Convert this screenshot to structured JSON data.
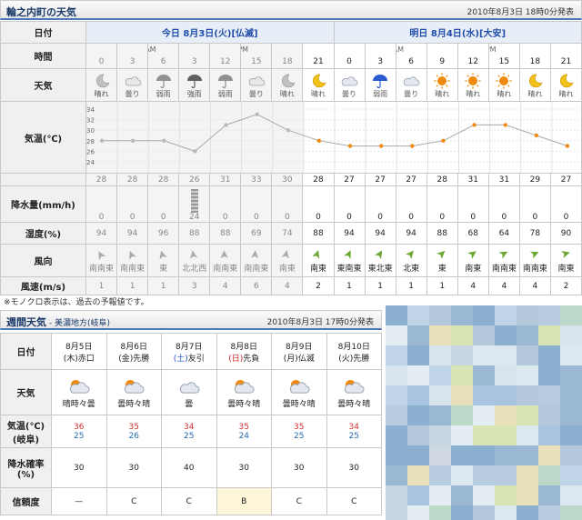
{
  "today_forecast": {
    "title": "輪之内町の天気",
    "issued": "2010年8月3日 18時0分発表",
    "labels": {
      "date": "日付",
      "time": "時間",
      "weather": "天気",
      "temp": "気温(℃)",
      "precip": "降水量(mm/h)",
      "humidity": "湿度(%)",
      "wind_dir": "風向",
      "wind_speed": "風速(m/s)"
    },
    "day1": {
      "prefix": "今日",
      "date": "8月3日",
      "dow": "(火)",
      "rokuyo": "[仏滅]"
    },
    "day2": {
      "prefix": "明日",
      "date": "8月4日",
      "dow": "(水)",
      "rokuyo": "[大安]"
    },
    "ampm": [
      "AM",
      "PM",
      "AM",
      "PM"
    ],
    "hours": [
      "0",
      "3",
      "6",
      "3",
      "12",
      "15",
      "18",
      "21",
      "0",
      "3",
      "6",
      "9",
      "12",
      "15",
      "18",
      "21"
    ],
    "weather": [
      "晴れ",
      "曇り",
      "弱雨",
      "強雨",
      "弱雨",
      "曇り",
      "晴れ",
      "晴れ",
      "曇り",
      "弱雨",
      "曇り",
      "晴れ",
      "晴れ",
      "晴れ",
      "晴れ",
      "晴れ"
    ],
    "weather_icons": [
      "moon-icon",
      "cloud-icon",
      "umbrella-icon",
      "umbrella-heavy-icon",
      "umbrella-icon",
      "cloud-icon",
      "moon-icon",
      "moon-icon",
      "cloud-icon",
      "umbrella-icon",
      "cloud-icon",
      "sun-icon",
      "sun-icon",
      "sun-icon",
      "moon-icon",
      "moon-icon"
    ],
    "temps": [
      "28",
      "28",
      "28",
      "26",
      "31",
      "33",
      "30",
      "28",
      "27",
      "27",
      "27",
      "28",
      "31",
      "31",
      "29",
      "27"
    ],
    "precip": [
      "0",
      "0",
      "0",
      "24",
      "0",
      "0",
      "0",
      "0",
      "0",
      "0",
      "0",
      "0",
      "0",
      "0",
      "0",
      "0"
    ],
    "humidity": [
      "94",
      "94",
      "96",
      "88",
      "88",
      "69",
      "74",
      "88",
      "94",
      "94",
      "94",
      "88",
      "68",
      "64",
      "78",
      "90"
    ],
    "wind_dir": [
      "南南東",
      "南南東",
      "東",
      "北北西",
      "南南東",
      "南南東",
      "南東",
      "南東",
      "東南東",
      "東北東",
      "北東",
      "東",
      "南東",
      "南南東",
      "南南東",
      "南東"
    ],
    "wind_speed": [
      "1",
      "1",
      "1",
      "3",
      "4",
      "6",
      "4",
      "2",
      "1",
      "1",
      "1",
      "1",
      "4",
      "4",
      "4",
      "2"
    ],
    "temp_axis": [
      "34",
      "32",
      "30",
      "28",
      "26",
      "24"
    ],
    "past_columns": 7,
    "note": "※モノクロ表示は、過去の予報値です。"
  },
  "chart_data": {
    "type": "line",
    "x": [
      "0",
      "3",
      "6",
      "3",
      "12",
      "15",
      "18",
      "21",
      "0",
      "3",
      "6",
      "9",
      "12",
      "15",
      "18",
      "21"
    ],
    "values": [
      28,
      28,
      28,
      26,
      31,
      33,
      30,
      28,
      27,
      27,
      27,
      28,
      31,
      31,
      29,
      27
    ],
    "ylim": [
      24,
      34
    ],
    "title": "",
    "xlabel": "",
    "ylabel": "気温(℃)"
  },
  "weekly": {
    "title": "週間天気",
    "region": " - 美濃地方(岐阜)",
    "issued": "2010年8月3日 17時0分発表",
    "labels": {
      "date": "日付",
      "weather": "天気",
      "temp1": "気温(℃)",
      "temp2": "(岐阜)",
      "pop1": "降水確率",
      "pop2": "(%)",
      "reliability": "信頼度"
    },
    "days": [
      {
        "date": "8月5日",
        "dow": "(木)",
        "rokuyo": "赤口",
        "weather": "晴時々曇",
        "max": "36",
        "min": "25",
        "pop": "30",
        "rel": "—",
        "dc": ""
      },
      {
        "date": "8月6日",
        "dow": "(金)",
        "rokuyo": "先勝",
        "weather": "曇時々晴",
        "max": "35",
        "min": "26",
        "pop": "30",
        "rel": "C",
        "dc": ""
      },
      {
        "date": "8月7日",
        "dow": "(土)",
        "rokuyo": "友引",
        "weather": "曇",
        "max": "34",
        "min": "25",
        "pop": "40",
        "rel": "C",
        "dc": "sat"
      },
      {
        "date": "8月8日",
        "dow": "(日)",
        "rokuyo": "先負",
        "weather": "曇時々晴",
        "max": "35",
        "min": "24",
        "pop": "30",
        "rel": "B",
        "dc": "sun"
      },
      {
        "date": "8月9日",
        "dow": "(月)",
        "rokuyo": "仏滅",
        "weather": "曇時々晴",
        "max": "35",
        "min": "25",
        "pop": "30",
        "rel": "C",
        "dc": ""
      },
      {
        "date": "8月10日",
        "dow": "(火)",
        "rokuyo": "先勝",
        "weather": "曇時々晴",
        "max": "34",
        "min": "25",
        "pop": "30",
        "rel": "C",
        "dc": ""
      }
    ]
  },
  "colors": {
    "accent": "#4a78b8",
    "sun": "#f08a10",
    "max": "#d03030",
    "min": "#2a6ab0"
  }
}
